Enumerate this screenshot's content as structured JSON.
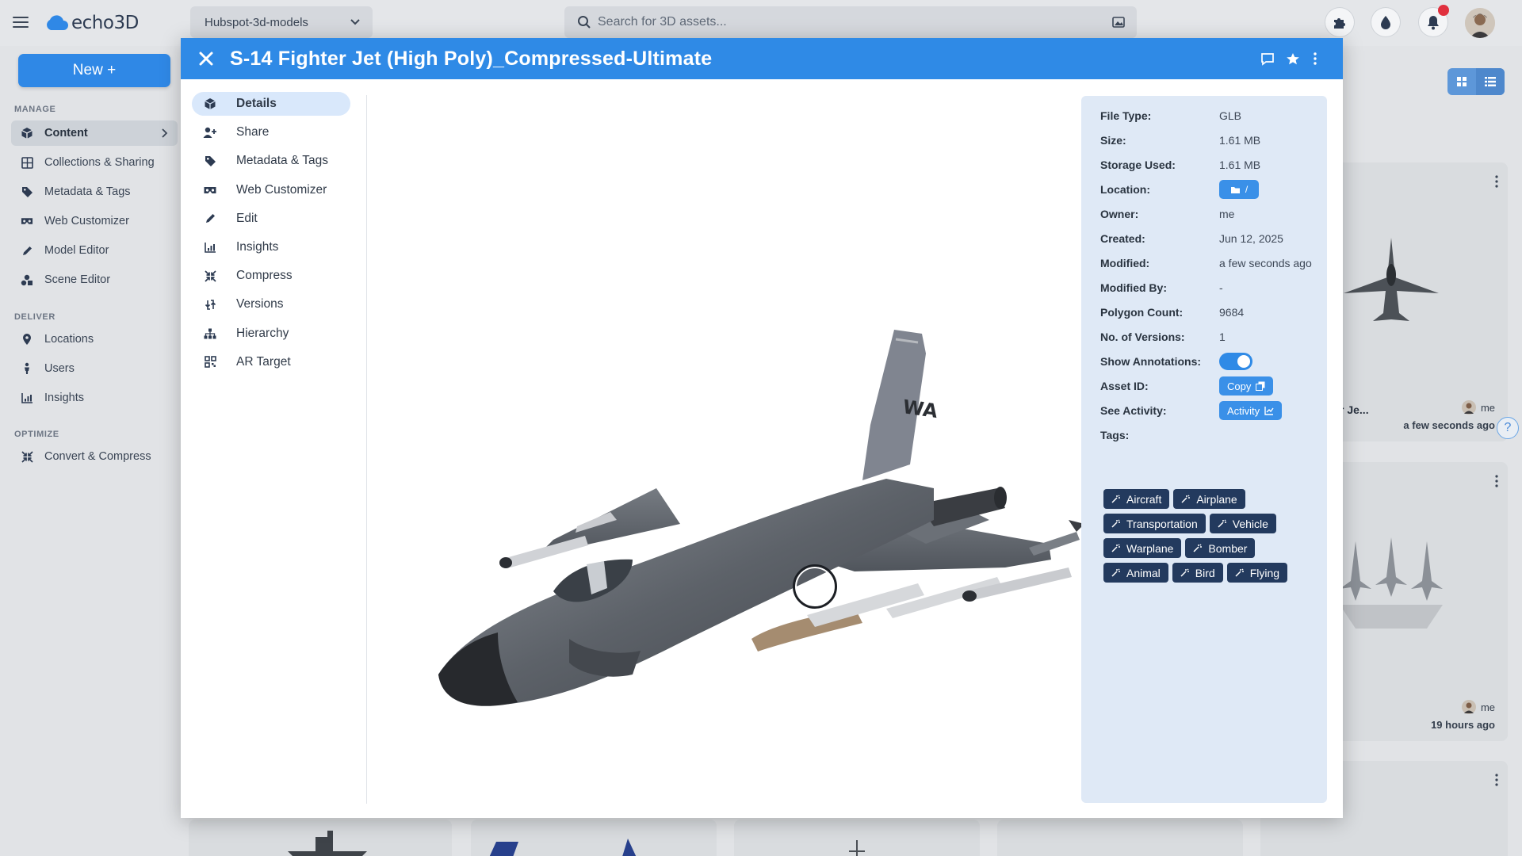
{
  "app": {
    "brand": "echo3D",
    "project": "Hubspot-3d-models",
    "search_placeholder": "Search for 3D assets..."
  },
  "colors": {
    "accent": "#2f8ae6",
    "tag_bg": "#233a5e",
    "panel_bg": "#dfe9f6",
    "notification": "#e0303e"
  },
  "sidebar": {
    "new_button": "New +",
    "sections": [
      {
        "label": "MANAGE",
        "items": [
          {
            "label": "Content",
            "icon": "cube-icon",
            "active": true
          },
          {
            "label": "Collections & Sharing",
            "icon": "grid-icon"
          },
          {
            "label": "Metadata & Tags",
            "icon": "tag-icon"
          },
          {
            "label": "Web Customizer",
            "icon": "vr-headset-icon"
          },
          {
            "label": "Model Editor",
            "icon": "pencil-icon"
          },
          {
            "label": "Scene Editor",
            "icon": "shapes-icon"
          }
        ]
      },
      {
        "label": "DELIVER",
        "items": [
          {
            "label": "Locations",
            "icon": "map-pin-icon"
          },
          {
            "label": "Users",
            "icon": "person-icon"
          },
          {
            "label": "Insights",
            "icon": "chart-icon"
          }
        ]
      },
      {
        "label": "OPTIMIZE",
        "items": [
          {
            "label": "Convert & Compress",
            "icon": "compress-icon"
          }
        ]
      }
    ]
  },
  "modal": {
    "title": "S-14 Fighter Jet (High Poly)_Compressed-Ultimate",
    "nav": [
      {
        "label": "Details",
        "icon": "cube-icon",
        "active": true
      },
      {
        "label": "Share",
        "icon": "add-user-icon"
      },
      {
        "label": "Metadata & Tags",
        "icon": "tag-icon"
      },
      {
        "label": "Web Customizer",
        "icon": "vr-headset-icon"
      },
      {
        "label": "Edit",
        "icon": "pencil-icon"
      },
      {
        "label": "Insights",
        "icon": "chart-icon"
      },
      {
        "label": "Compress",
        "icon": "compress-icon"
      },
      {
        "label": "Versions",
        "icon": "versions-icon"
      },
      {
        "label": "Hierarchy",
        "icon": "hierarchy-icon"
      },
      {
        "label": "AR Target",
        "icon": "qr-icon"
      }
    ],
    "details": {
      "file_type_label": "File Type:",
      "file_type": "GLB",
      "size_label": "Size:",
      "size": "1.61 MB",
      "storage_label": "Storage Used:",
      "storage": "1.61 MB",
      "location_label": "Location:",
      "location": "/",
      "owner_label": "Owner:",
      "owner": "me",
      "created_label": "Created:",
      "created": "Jun 12, 2025",
      "modified_label": "Modified:",
      "modified": "a few seconds ago",
      "modified_by_label": "Modified By:",
      "modified_by": "-",
      "polygon_label": "Polygon Count:",
      "polygon_count": "9684",
      "versions_label": "No. of Versions:",
      "versions": "1",
      "annotations_label": "Show Annotations:",
      "annotations_on": true,
      "asset_id_label": "Asset ID:",
      "copy_button": "Copy",
      "activity_label": "See Activity:",
      "activity_button": "Activity",
      "tags_label": "Tags:"
    },
    "tags": [
      [
        "Aircraft",
        "Airplane"
      ],
      [
        "Transportation",
        "Vehicle"
      ],
      [
        "Warplane",
        "Bomber"
      ],
      [
        "Animal",
        "Bird",
        "Flying"
      ]
    ]
  },
  "background_cards": [
    {
      "title_fragment": "r Je...",
      "owner": "me",
      "time": "a few seconds ago"
    },
    {
      "owner": "me",
      "time": "19 hours ago"
    }
  ]
}
